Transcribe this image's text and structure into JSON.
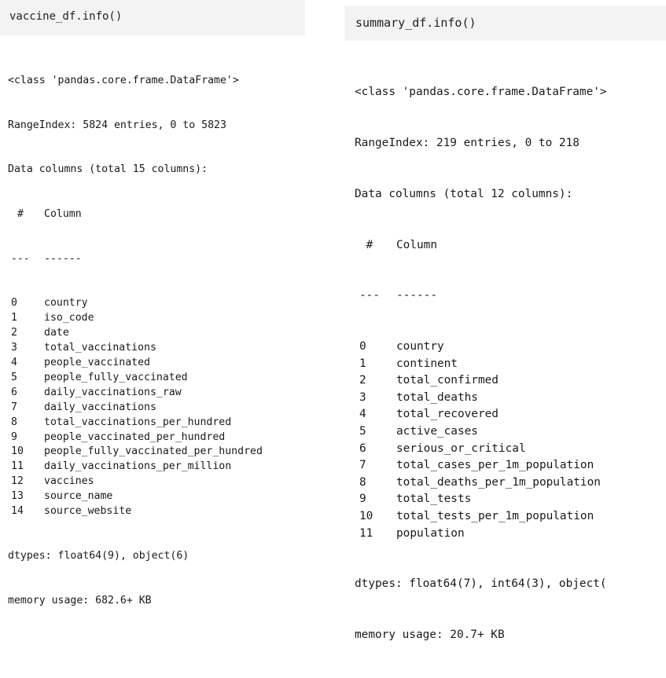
{
  "left": {
    "code": "vaccine_df.info()",
    "class_line": "<class 'pandas.core.frame.DataFrame'>",
    "range_line": "RangeIndex: 5824 entries, 0 to 5823",
    "columns_line": "Data columns (total 15 columns):",
    "header_idx": " #",
    "header_col": "Column",
    "sep_idx": "---",
    "sep_col": "------",
    "columns": [
      {
        "idx": "0",
        "name": "country"
      },
      {
        "idx": "1",
        "name": "iso_code"
      },
      {
        "idx": "2",
        "name": "date"
      },
      {
        "idx": "3",
        "name": "total_vaccinations"
      },
      {
        "idx": "4",
        "name": "people_vaccinated"
      },
      {
        "idx": "5",
        "name": "people_fully_vaccinated"
      },
      {
        "idx": "6",
        "name": "daily_vaccinations_raw"
      },
      {
        "idx": "7",
        "name": "daily_vaccinations"
      },
      {
        "idx": "8",
        "name": "total_vaccinations_per_hundred"
      },
      {
        "idx": "9",
        "name": "people_vaccinated_per_hundred"
      },
      {
        "idx": "10",
        "name": "people_fully_vaccinated_per_hundred"
      },
      {
        "idx": "11",
        "name": "daily_vaccinations_per_million"
      },
      {
        "idx": "12",
        "name": "vaccines"
      },
      {
        "idx": "13",
        "name": "source_name"
      },
      {
        "idx": "14",
        "name": "source_website"
      }
    ],
    "dtypes_line": "dtypes: float64(9), object(6)",
    "memory_line": "memory usage: 682.6+ KB"
  },
  "right": {
    "code": "summary_df.info()",
    "class_line": "<class 'pandas.core.frame.DataFrame'>",
    "range_line": "RangeIndex: 219 entries, 0 to 218",
    "columns_line": "Data columns (total 12 columns):",
    "header_idx": " #",
    "header_col": "Column",
    "sep_idx": "---",
    "sep_col": "------",
    "columns": [
      {
        "idx": "0",
        "name": "country"
      },
      {
        "idx": "1",
        "name": "continent"
      },
      {
        "idx": "2",
        "name": "total_confirmed"
      },
      {
        "idx": "3",
        "name": "total_deaths"
      },
      {
        "idx": "4",
        "name": "total_recovered"
      },
      {
        "idx": "5",
        "name": "active_cases"
      },
      {
        "idx": "6",
        "name": "serious_or_critical"
      },
      {
        "idx": "7",
        "name": "total_cases_per_1m_population"
      },
      {
        "idx": "8",
        "name": "total_deaths_per_1m_population"
      },
      {
        "idx": "9",
        "name": "total_tests"
      },
      {
        "idx": "10",
        "name": "total_tests_per_1m_population"
      },
      {
        "idx": "11",
        "name": "population"
      }
    ],
    "dtypes_line": "dtypes: float64(7), int64(3), object(",
    "memory_line": "memory usage: 20.7+ KB"
  }
}
